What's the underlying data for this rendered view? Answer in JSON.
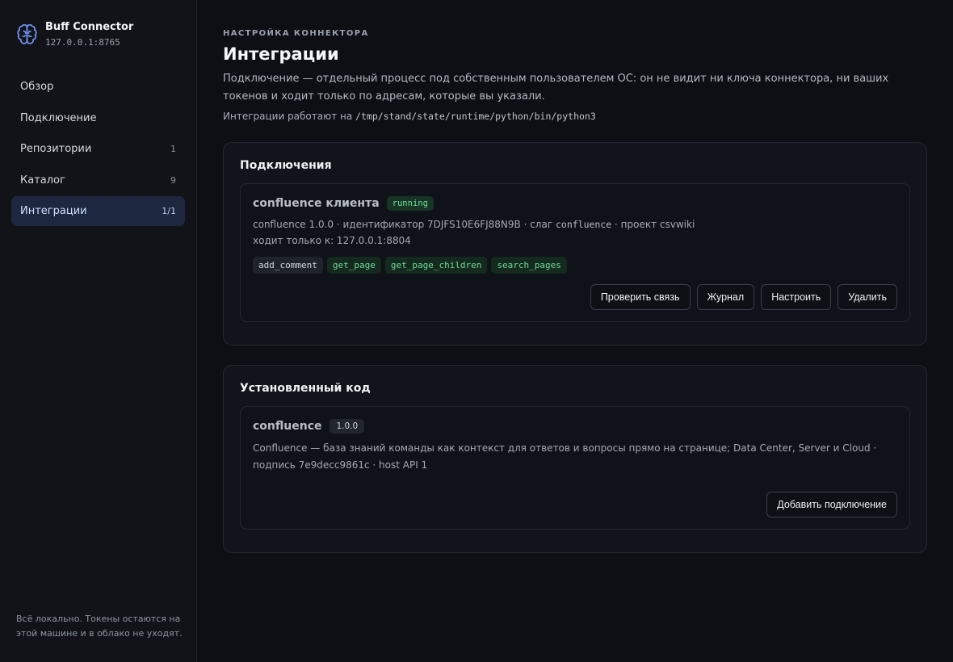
{
  "brand": {
    "name": "Buff Connector",
    "address": "127.0.0.1:8765"
  },
  "nav": [
    {
      "label": "Обзор",
      "count": ""
    },
    {
      "label": "Подключение",
      "count": ""
    },
    {
      "label": "Репозитории",
      "count": "1"
    },
    {
      "label": "Каталог",
      "count": "9"
    },
    {
      "label": "Интеграции",
      "count": "1/1",
      "active": true
    }
  ],
  "sidebar_footer": "Всё локально. Токены остаются на этой машине и в облако не уходят.",
  "header": {
    "eyebrow": "НАСТРОЙКА КОННЕКТОРА",
    "title": "Интеграции",
    "lead": "Подключение — отдельный процесс под собственным пользователем ОС: он не видит ни ключа коннектора, ни ваших токенов и ходит только по адресам, которые вы указали.",
    "runtime_prefix": "Интеграции работают на",
    "runtime_path": "/tmp/stand/state/runtime/python/bin/python3"
  },
  "connections": {
    "title": "Подключения",
    "card": {
      "name": "confluence клиента",
      "status": "running",
      "meta_prefix": "confluence 1.0.0 · идентификатор 7DJFS10E6FJ88N9B · слаг",
      "slug": "confluence",
      "meta_suffix": "· проект csvwiki",
      "access": "ходит только к: 127.0.0.1:8804",
      "tools": [
        {
          "name": "add_comment",
          "style": "neutral"
        },
        {
          "name": "get_page",
          "style": "green"
        },
        {
          "name": "get_page_children",
          "style": "green"
        },
        {
          "name": "search_pages",
          "style": "green"
        }
      ],
      "actions": {
        "check": "Проверить связь",
        "log": "Журнал",
        "configure": "Настроить",
        "delete": "Удалить"
      }
    }
  },
  "installed": {
    "title": "Установленный код",
    "card": {
      "name": "confluence",
      "version": "1.0.0",
      "description": "Confluence — база знаний команды как контекст для ответов и вопросы прямо на странице; Data Center, Server и Cloud · подпись 7e9decc9861c · host API 1",
      "add_label": "Добавить подключение"
    }
  }
}
